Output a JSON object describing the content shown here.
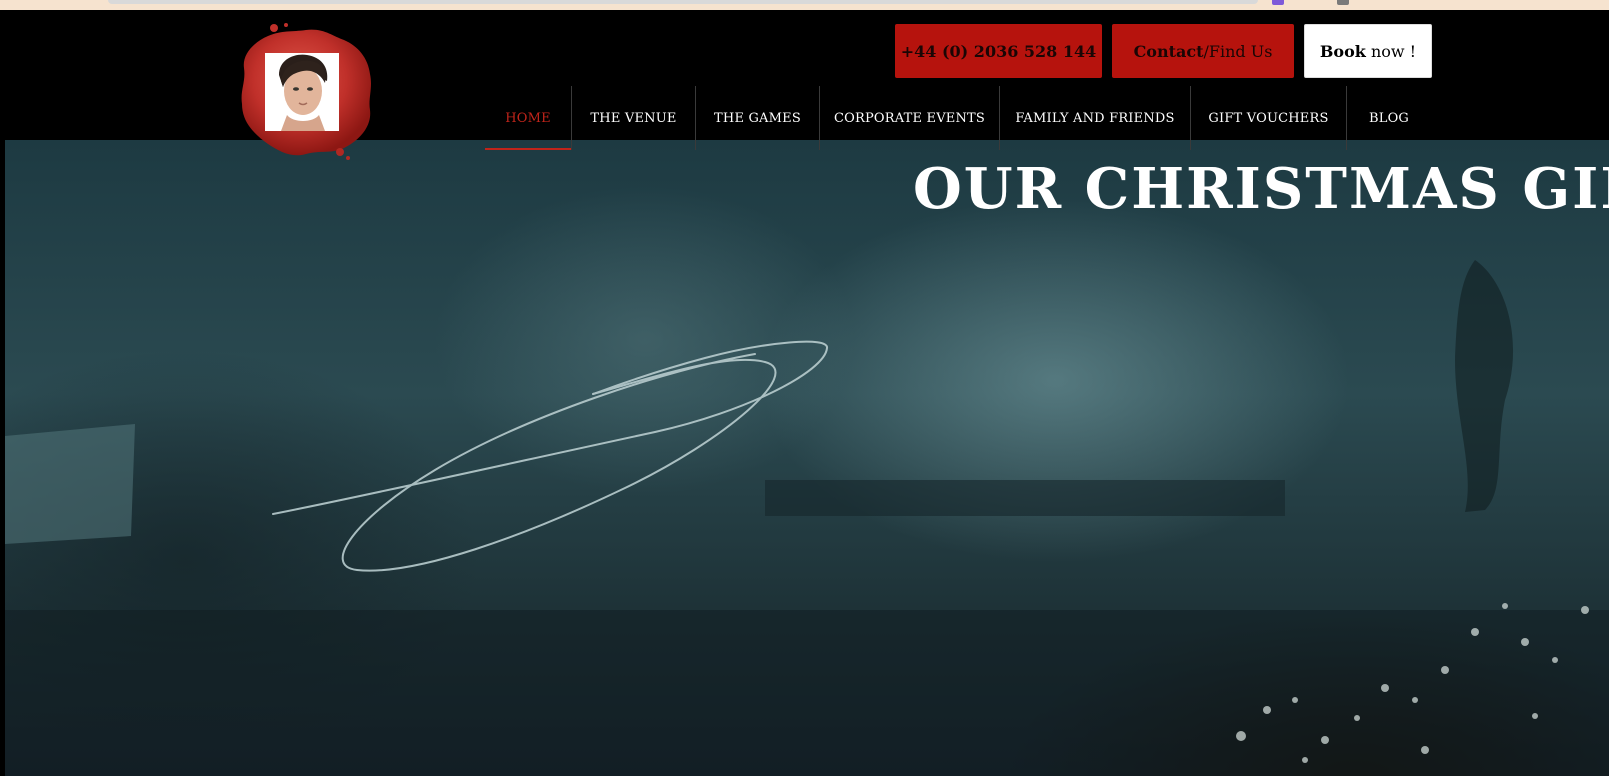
{
  "header": {
    "cta": {
      "phone_label": "+44 (0) 2036 528 144",
      "contact_bold": "Contact",
      "contact_rest": "/Find Us",
      "book_bold": "Book",
      "book_rest": " now !"
    },
    "nav": {
      "items": [
        {
          "label": "HOME",
          "active": true
        },
        {
          "label": "THE VENUE",
          "active": false
        },
        {
          "label": "THE GAMES",
          "active": false
        },
        {
          "label": "CORPORATE EVENTS",
          "active": false
        },
        {
          "label": "FAMILY AND FRIENDS",
          "active": false
        },
        {
          "label": "GIFT VOUCHERS",
          "active": false
        },
        {
          "label": "BLOG",
          "active": false
        }
      ]
    }
  },
  "hero": {
    "title": "OUR CHRISTMAS GIFT V"
  },
  "colors": {
    "accent_red": "#b6130d",
    "active_nav": "#c0241a",
    "header_bg": "#000000",
    "browser_strip": "#f6e3cf"
  },
  "icons": {
    "logo": "wax-seal-logo-icon",
    "portrait": "portrait-photo"
  }
}
